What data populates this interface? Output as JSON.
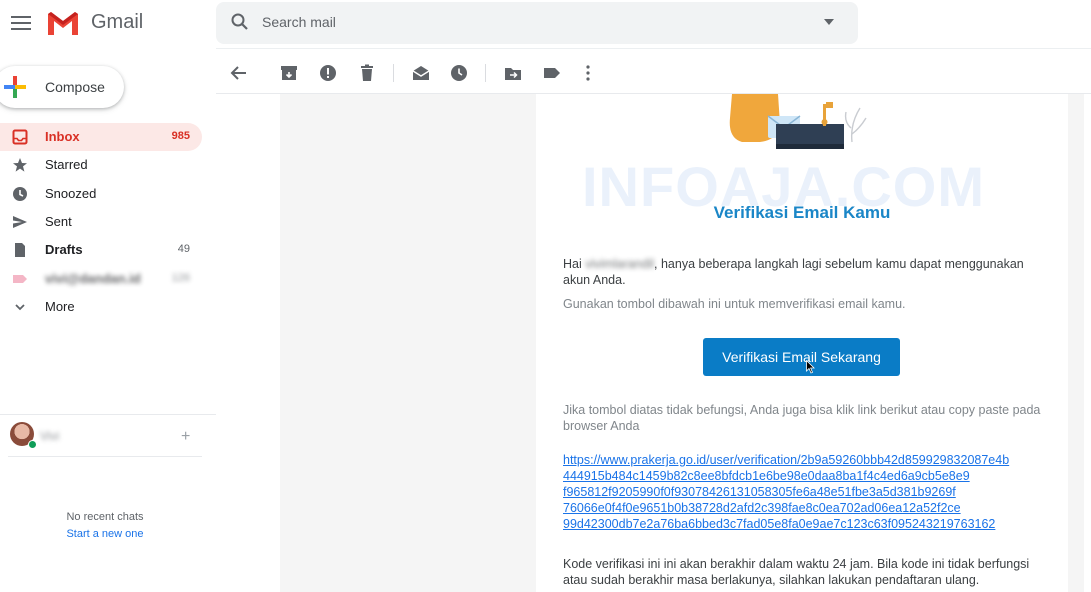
{
  "header": {
    "brand": "Gmail",
    "search_placeholder": "Search mail"
  },
  "sidebar": {
    "compose_label": "Compose",
    "items": [
      {
        "label": "Inbox",
        "count": "985",
        "icon": "inbox-icon"
      },
      {
        "label": "Starred",
        "count": "",
        "icon": "star-icon"
      },
      {
        "label": "Snoozed",
        "count": "",
        "icon": "clock-icon"
      },
      {
        "label": "Sent",
        "count": "",
        "icon": "send-icon"
      },
      {
        "label": "Drafts",
        "count": "49",
        "icon": "draft-icon"
      },
      {
        "label": "vivi@dandan.id",
        "count": "126",
        "icon": "label-icon"
      },
      {
        "label": "More",
        "count": "",
        "icon": "chevron-down-icon"
      }
    ]
  },
  "hangouts": {
    "user_name": "Vivi",
    "no_chats": "No recent chats",
    "start_new": "Start a new one"
  },
  "toolbar": {
    "icons": [
      "back-arrow-icon",
      "archive-icon",
      "report-spam-icon",
      "delete-icon",
      "mark-unread-icon",
      "snooze-icon",
      "move-to-icon",
      "label-icon",
      "more-vert-icon"
    ]
  },
  "email": {
    "watermark": "INFOAJA.COM",
    "heading": "Verifikasi Email Kamu",
    "greeting_prefix": "Hai",
    "greeting_name": "vivimlarandil",
    "greeting_text": ", hanya beberapa langkah lagi sebelum kamu dapat menggunakan akun Anda.",
    "instruction": "Gunakan tombol dibawah ini untuk memverifikasi email kamu.",
    "button_label": "Verifikasi Email Sekarang",
    "fallback_text": "Jika tombol diatas tidak befungsi, Anda juga bisa klik link berikut atau copy paste pada browser Anda",
    "link_lines": [
      "https://www.prakerja.go.id/user/verification/2b9a59260bbb42d859929832087e4b",
      "444915b484c1459b82c8ee8bfdcb1e6be98e0daa8ba1f4c4ed6a9cb5e8e9",
      "f965812f9205990f0f93078426131058305fe6a48e51fbe3a5d381b9269f",
      "76066e0f4f0e9651b0b38728d2afd2c398fae8c0ea702ad06ea12a52f2ce",
      "99d42300db7e2a76ba6bbed3c7fad05e8fa0e9ae7c123c63f095243219763162"
    ],
    "expiry_text": "Kode verifikasi ini ini akan berakhir dalam waktu 24 jam. Bila kode ini tidak berfungsi atau sudah berakhir masa berlakunya, silahkan lakukan pendaftaran ulang."
  },
  "colors": {
    "gmail_red": "#d93025",
    "button_blue": "#0a7cc6",
    "heading_blue": "#1a86c7",
    "link_blue": "#1a73e8"
  }
}
